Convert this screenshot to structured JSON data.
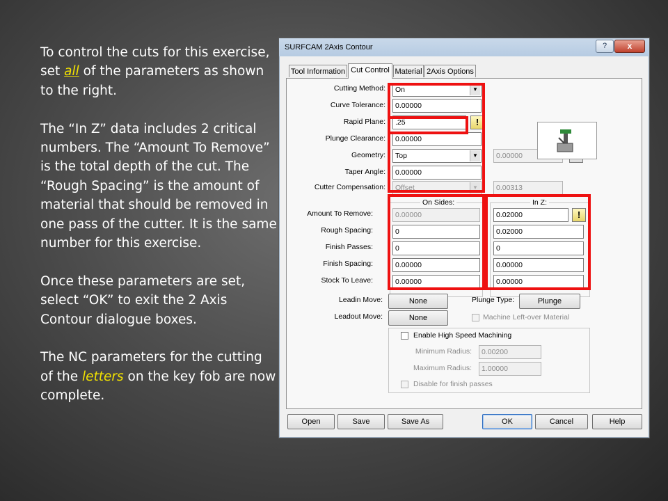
{
  "slide": {
    "paragraphs": [
      {
        "before": "To control the cuts for this exercise, set ",
        "highlight": "all",
        "after": " of the parameters as shown to the right."
      },
      {
        "text": "The “In Z” data includes 2 critical numbers. The “Amount To Remove” is the total depth of the cut. The “Rough Spacing” is the amount of material that should be removed in one pass of the cutter. It is the same number for this exercise."
      },
      {
        "text": "Once these parameters are set, select “OK” to exit the 2 Axis Contour dialogue boxes."
      },
      {
        "before": "The NC parameters for the cutting of the ",
        "highlight": "letters",
        "after": " on the key fob are now complete."
      }
    ],
    "highlight_color": "#f2e200"
  },
  "dialog": {
    "title": "SURFCAM 2Axis Contour",
    "help_label": "?",
    "close_label": "x",
    "tabs": [
      "Tool Information",
      "Cut Control",
      "Material",
      "2Axis Options"
    ],
    "active_tab": "Cut Control",
    "fields": {
      "cutting_method": {
        "label": "Cutting Method:",
        "value": "On"
      },
      "curve_tolerance": {
        "label": "Curve Tolerance:",
        "value": "0.00000"
      },
      "rapid_plane": {
        "label": "Rapid Plane:",
        "value": ".25"
      },
      "plunge_clearance": {
        "label": "Plunge Clearance:",
        "value": "0.00000"
      },
      "geometry": {
        "label": "Geometry:",
        "value": "Top",
        "side_value": "0.00000"
      },
      "taper_angle": {
        "label": "Taper Angle:",
        "value": "0.00000"
      },
      "cutter_compensation": {
        "label": "Cutter Compensation:",
        "value": "Offset",
        "side_value": "0.00313"
      }
    },
    "on_sides": {
      "title": "On Sides:",
      "values": [
        "0.00000",
        "0",
        "0",
        "0.00000",
        "0.00000"
      ]
    },
    "in_z": {
      "title": "In Z:",
      "values": [
        "0.02000",
        "0.02000",
        "0",
        "0.00000",
        "0.00000"
      ]
    },
    "row_labels": [
      "Amount To Remove:",
      "Rough Spacing:",
      "Finish Passes:",
      "Finish Spacing:",
      "Stock To Leave:"
    ],
    "leadin": {
      "label": "Leadin Move:",
      "value": "None"
    },
    "leadout": {
      "label": "Leadout Move:",
      "value": "None"
    },
    "plunge_type": {
      "label": "Plunge Type:",
      "value": "Plunge"
    },
    "machine_leftover": "Machine Left-over Material",
    "high_speed": {
      "label": "Enable High Speed Machining",
      "min_radius": {
        "label": "Minimum Radius:",
        "value": "0.00200"
      },
      "max_radius": {
        "label": "Maximum Radius:",
        "value": "1.00000"
      },
      "disable_finish": "Disable for finish passes"
    },
    "buttons": [
      "Open",
      "Save",
      "Save As",
      "OK",
      "Cancel",
      "Help"
    ],
    "annotation_color": "#ee1111"
  }
}
